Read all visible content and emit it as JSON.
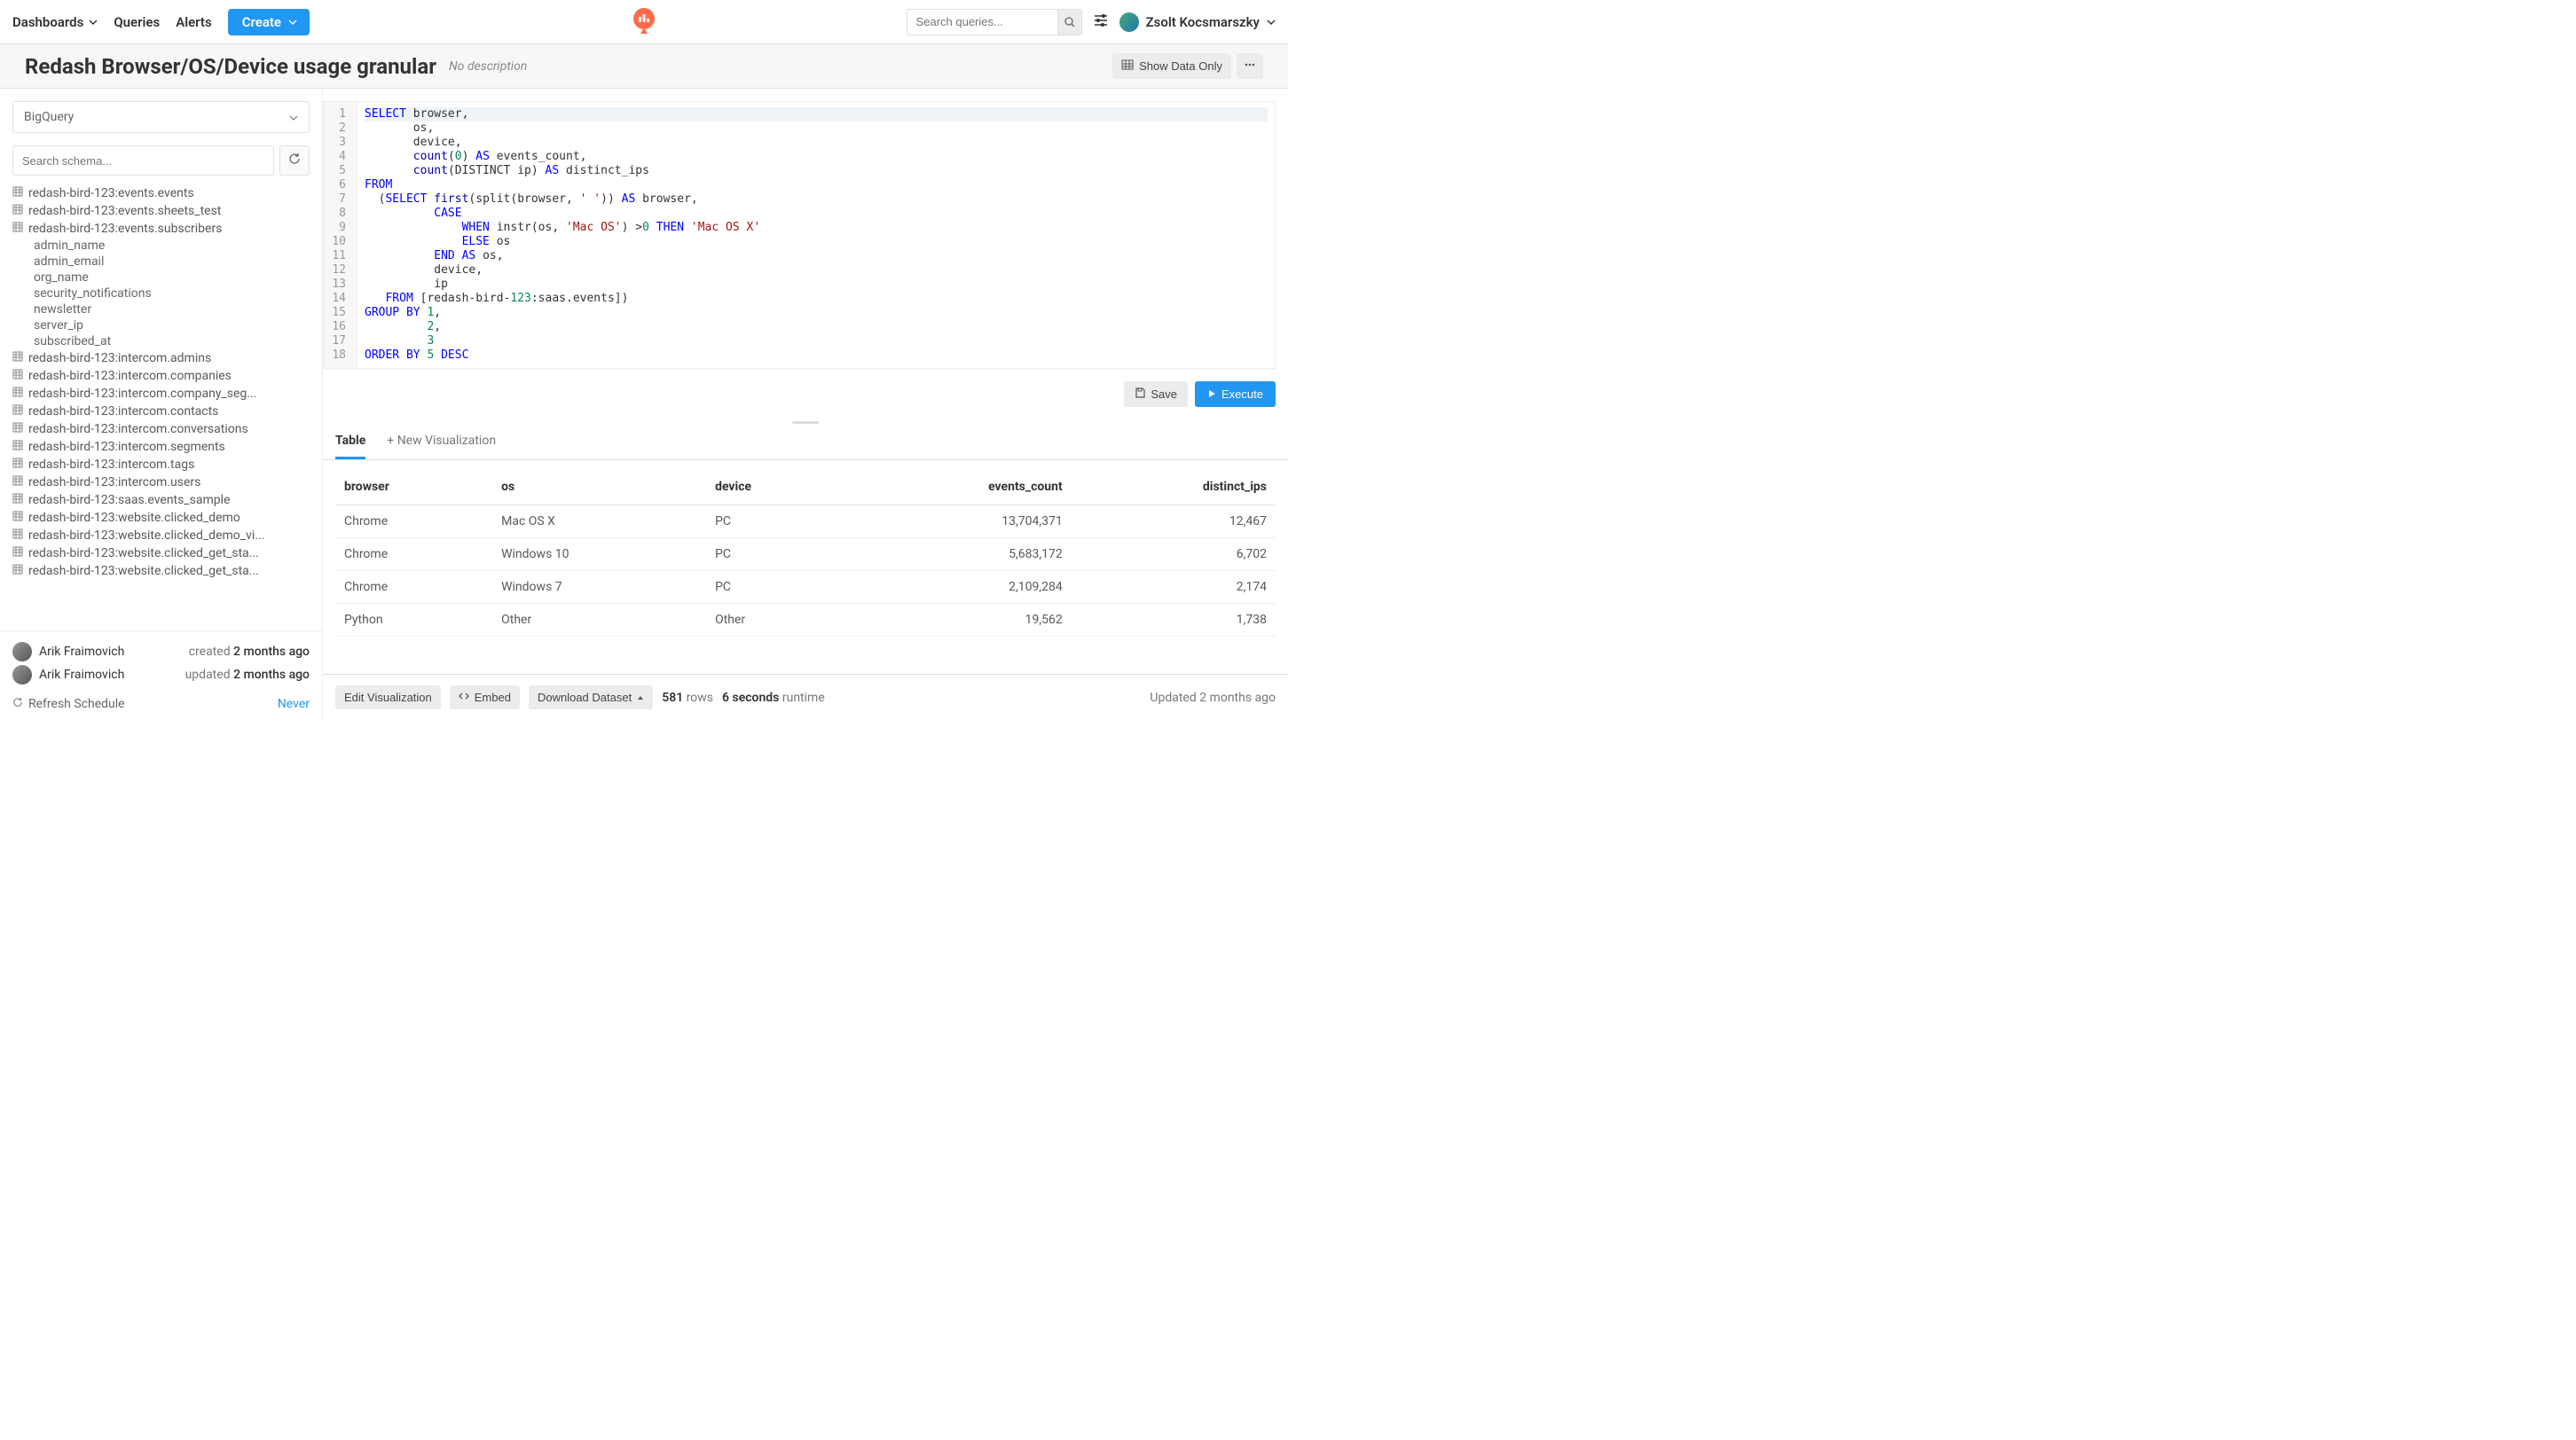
{
  "nav": {
    "dashboards": "Dashboards",
    "queries": "Queries",
    "alerts": "Alerts",
    "create": "Create",
    "search_placeholder": "Search queries...",
    "user_name": "Zsolt Kocsmarszky"
  },
  "header": {
    "title": "Redash Browser/OS/Device usage granular",
    "description": "No description",
    "show_data_only": "Show Data Only"
  },
  "sidebar": {
    "datasource": "BigQuery",
    "schema_search_placeholder": "Search schema...",
    "tables": [
      {
        "name": "redash-bird-123:events.events",
        "expanded": false
      },
      {
        "name": "redash-bird-123:events.sheets_test",
        "expanded": false
      },
      {
        "name": "redash-bird-123:events.subscribers",
        "expanded": true,
        "columns": [
          "admin_name",
          "admin_email",
          "org_name",
          "security_notifications",
          "newsletter",
          "server_ip",
          "subscribed_at"
        ]
      },
      {
        "name": "redash-bird-123:intercom.admins",
        "expanded": false
      },
      {
        "name": "redash-bird-123:intercom.companies",
        "expanded": false
      },
      {
        "name": "redash-bird-123:intercom.company_seg...",
        "expanded": false
      },
      {
        "name": "redash-bird-123:intercom.contacts",
        "expanded": false
      },
      {
        "name": "redash-bird-123:intercom.conversations",
        "expanded": false
      },
      {
        "name": "redash-bird-123:intercom.segments",
        "expanded": false
      },
      {
        "name": "redash-bird-123:intercom.tags",
        "expanded": false
      },
      {
        "name": "redash-bird-123:intercom.users",
        "expanded": false
      },
      {
        "name": "redash-bird-123:saas.events_sample",
        "expanded": false
      },
      {
        "name": "redash-bird-123:website.clicked_demo",
        "expanded": false
      },
      {
        "name": "redash-bird-123:website.clicked_demo_vi...",
        "expanded": false
      },
      {
        "name": "redash-bird-123:website.clicked_get_sta...",
        "expanded": false
      },
      {
        "name": "redash-bird-123:website.clicked_get_sta...",
        "expanded": false
      }
    ],
    "meta": {
      "created_by": "Arik Fraimovich",
      "created_text": "created",
      "created_when": "2 months ago",
      "updated_by": "Arik Fraimovich",
      "updated_text": "updated",
      "updated_when": "2 months ago",
      "refresh_label": "Refresh Schedule",
      "refresh_value": "Never"
    }
  },
  "editor": {
    "lines": 18,
    "sql_tokens": [
      [
        [
          "kw",
          "SELECT"
        ],
        [
          "",
          " browser,"
        ]
      ],
      [
        [
          "",
          "       os,"
        ]
      ],
      [
        [
          "",
          "       device,"
        ]
      ],
      [
        [
          "",
          "       "
        ],
        [
          "fn",
          "count"
        ],
        [
          "",
          "("
        ],
        [
          "num",
          "0"
        ],
        [
          "",
          ") "
        ],
        [
          "kw",
          "AS"
        ],
        [
          "",
          " events_count,"
        ]
      ],
      [
        [
          "",
          "       "
        ],
        [
          "fn",
          "count"
        ],
        [
          "",
          "(DISTINCT ip) "
        ],
        [
          "kw",
          "AS"
        ],
        [
          "",
          " distinct_ips"
        ]
      ],
      [
        [
          "kw",
          "FROM"
        ]
      ],
      [
        [
          "",
          "  ("
        ],
        [
          "kw",
          "SELECT"
        ],
        [
          "",
          " "
        ],
        [
          "fn",
          "first"
        ],
        [
          "",
          "(split(browser, "
        ],
        [
          "str",
          "' '"
        ],
        [
          "",
          ")) "
        ],
        [
          "kw",
          "AS"
        ],
        [
          "",
          " browser,"
        ]
      ],
      [
        [
          "",
          "          "
        ],
        [
          "kw",
          "CASE"
        ]
      ],
      [
        [
          "",
          "              "
        ],
        [
          "kw",
          "WHEN"
        ],
        [
          "",
          " instr(os, "
        ],
        [
          "str",
          "'Mac OS'"
        ],
        [
          "",
          ") >"
        ],
        [
          "num",
          "0"
        ],
        [
          "",
          " "
        ],
        [
          "kw",
          "THEN"
        ],
        [
          "",
          " "
        ],
        [
          "str",
          "'Mac OS X'"
        ]
      ],
      [
        [
          "",
          "              "
        ],
        [
          "kw",
          "ELSE"
        ],
        [
          "",
          " os"
        ]
      ],
      [
        [
          "",
          "          "
        ],
        [
          "kw",
          "END"
        ],
        [
          "",
          " "
        ],
        [
          "kw",
          "AS"
        ],
        [
          "",
          " os,"
        ]
      ],
      [
        [
          "",
          "          device,"
        ]
      ],
      [
        [
          "",
          "          ip"
        ]
      ],
      [
        [
          "",
          "   "
        ],
        [
          "kw",
          "FROM"
        ],
        [
          "",
          " [redash-bird-"
        ],
        [
          "num",
          "123"
        ],
        [
          "",
          ":saas.events])"
        ]
      ],
      [
        [
          "kw",
          "GROUP BY"
        ],
        [
          "",
          " "
        ],
        [
          "num",
          "1"
        ],
        [
          "",
          ","
        ]
      ],
      [
        [
          "",
          "         "
        ],
        [
          "num",
          "2"
        ],
        [
          "",
          ","
        ]
      ],
      [
        [
          "",
          "         "
        ],
        [
          "num",
          "3"
        ]
      ],
      [
        [
          "kw",
          "ORDER BY"
        ],
        [
          "",
          " "
        ],
        [
          "num",
          "5"
        ],
        [
          "",
          " "
        ],
        [
          "kw",
          "DESC"
        ]
      ]
    ],
    "save_label": "Save",
    "execute_label": "Execute"
  },
  "results": {
    "tabs": {
      "table": "Table",
      "new_viz": "+ New Visualization"
    },
    "columns": [
      "browser",
      "os",
      "device",
      "events_count",
      "distinct_ips"
    ],
    "numeric_cols": [
      false,
      false,
      false,
      true,
      true
    ],
    "rows": [
      [
        "Chrome",
        "Mac OS X",
        "PC",
        "13,704,371",
        "12,467"
      ],
      [
        "Chrome",
        "Windows 10",
        "PC",
        "5,683,172",
        "6,702"
      ],
      [
        "Chrome",
        "Windows 7",
        "PC",
        "2,109,284",
        "2,174"
      ],
      [
        "Python",
        "Other",
        "Other",
        "19,562",
        "1,738"
      ]
    ],
    "footer": {
      "edit_viz": "Edit Visualization",
      "embed": "Embed",
      "download": "Download Dataset",
      "rows_count": "581",
      "rows_label": "rows",
      "runtime_value": "6 seconds",
      "runtime_label": "runtime",
      "updated": "Updated 2 months ago"
    }
  }
}
